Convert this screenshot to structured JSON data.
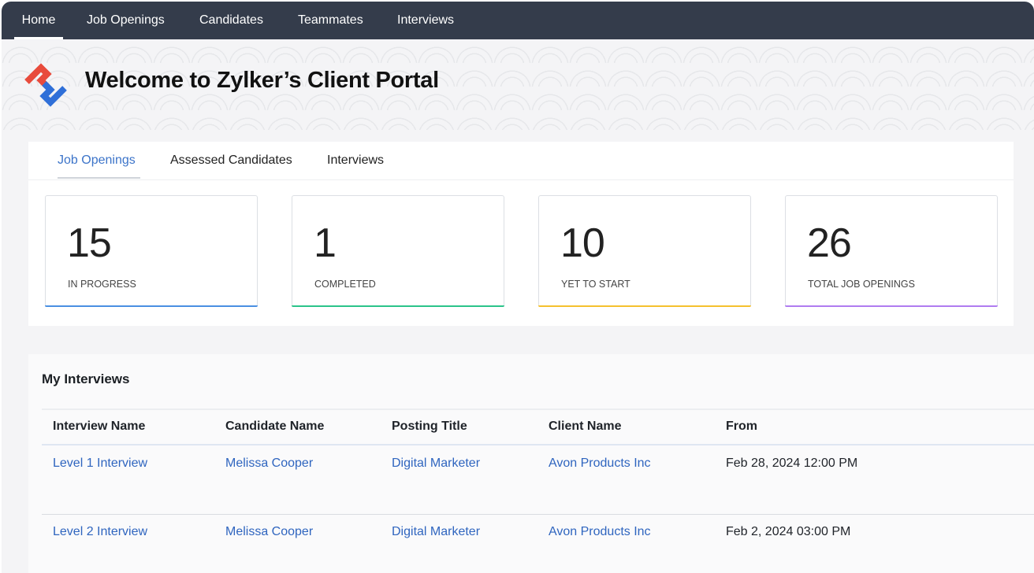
{
  "nav": {
    "items": [
      "Home",
      "Job Openings",
      "Candidates",
      "Teammates",
      "Interviews"
    ],
    "active": "Home"
  },
  "banner": {
    "title": "Welcome  to Zylker’s Client Portal"
  },
  "tabs": {
    "items": [
      "Job Openings",
      "Assessed Candidates",
      "Interviews"
    ],
    "active": "Job Openings",
    "accent_color": "#3c74c9"
  },
  "stats": [
    {
      "value": "15",
      "label": "IN PROGRESS",
      "color": "#4a90e2"
    },
    {
      "value": "1",
      "label": "COMPLETED",
      "color": "#2bc48a"
    },
    {
      "value": "10",
      "label": "YET TO START",
      "color": "#f5c12e"
    },
    {
      "value": "26",
      "label": "TOTAL JOB OPENINGS",
      "color": "#b07cf0"
    }
  ],
  "interviews": {
    "title": "My Interviews",
    "columns": [
      "Interview Name",
      "Candidate Name",
      "Posting Title",
      "Client Name",
      "From"
    ],
    "rows": [
      [
        "Level 1 Interview",
        "Melissa Cooper",
        "Digital Marketer",
        "Avon Products Inc",
        "Feb 28, 2024 12:00 PM"
      ],
      [
        "Level 2 Interview",
        "Melissa Cooper",
        "Digital Marketer",
        "Avon Products Inc",
        "Feb 2, 2024 03:00 PM"
      ]
    ],
    "link_color": "#2f65bf"
  },
  "colors": {
    "nav_bg": "#343c4b",
    "page_bg": "#f4f4f6",
    "logo_red": "#e84b3c",
    "logo_blue": "#2f6fd8"
  }
}
